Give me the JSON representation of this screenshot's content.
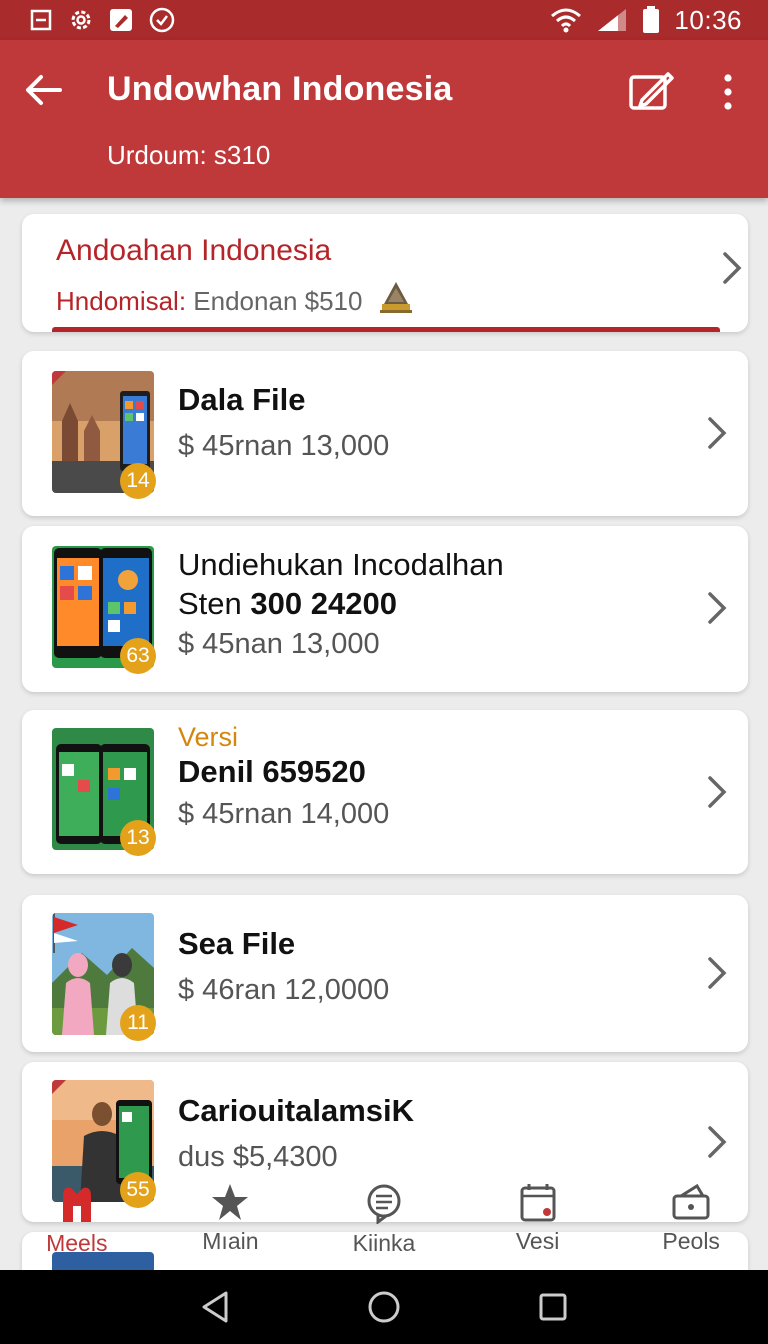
{
  "status_bar": {
    "time": "10:36"
  },
  "app_bar": {
    "title": "Undowhan Indonesia",
    "subtitle": "Urdoum: s310"
  },
  "header_card": {
    "title": "Andoahan Indonesia",
    "label": "Hndomisal:",
    "value": "Endonan $510"
  },
  "items": [
    {
      "kicker": "",
      "title": "Dala File",
      "title_line2_normal": "",
      "title_line2_bold": "",
      "price": "$ 45rnan 13,000",
      "badge": "14"
    },
    {
      "kicker": "",
      "title": "Undiehukan Incodalhan",
      "title_line2_normal": "Sten ",
      "title_line2_bold": "300 24200",
      "price": "$ 45nan 13,000",
      "badge": "63"
    },
    {
      "kicker": "Versi",
      "title": "Denil 659520",
      "title_line2_normal": "",
      "title_line2_bold": "",
      "price": "$ 45rnan 14,000",
      "badge": "13"
    },
    {
      "kicker": "",
      "title": "Sea File",
      "title_line2_normal": "",
      "title_line2_bold": "",
      "price": "$ 46ran 12,0000",
      "badge": "11"
    },
    {
      "kicker": "",
      "title": "CariouitalamsiK",
      "title_line2_normal": "",
      "title_line2_bold": "",
      "price": "dus $5,4300",
      "badge": "55"
    }
  ],
  "bottom_nav": [
    {
      "label": "Meels",
      "icon": "home-icon",
      "active": true
    },
    {
      "label": "Mıain",
      "icon": "star-icon",
      "active": false
    },
    {
      "label": "Kiinka",
      "icon": "chat-icon",
      "active": false
    },
    {
      "label": "Vesi",
      "icon": "calendar-icon",
      "active": false
    },
    {
      "label": "Peols",
      "icon": "wallet-icon",
      "active": false
    }
  ],
  "colors": {
    "primary": "#c0393a",
    "status_bar": "#a92b2b",
    "accent": "#e3a21a",
    "kicker": "#d4870e"
  }
}
